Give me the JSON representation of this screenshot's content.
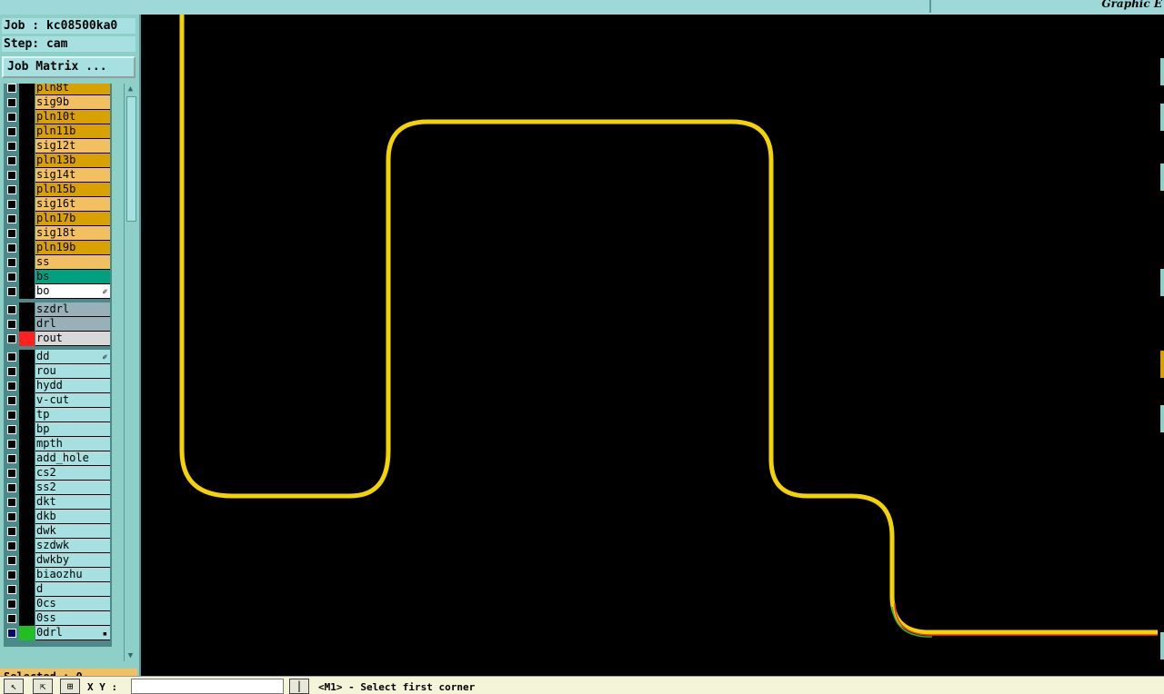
{
  "window": {
    "title": "Graphic E"
  },
  "job": {
    "label": "Job : kc08500ka0"
  },
  "step": {
    "label": "Step: cam"
  },
  "job_matrix_button": "Job Matrix ...",
  "selected": "Selected : 0",
  "bottom": {
    "xy_label": "X Y :",
    "xy_value": "",
    "status_message": "<M1> - Select first corner",
    "pipe_label": "|"
  },
  "layers": [
    {
      "name": "pln8t",
      "color": "#d8a000",
      "swatch": "",
      "checked": false
    },
    {
      "name": "sig9b",
      "color": "#f2c060",
      "swatch": "",
      "checked": false
    },
    {
      "name": "pln10t",
      "color": "#d8a000",
      "swatch": "",
      "checked": false
    },
    {
      "name": "pln11b",
      "color": "#d8a000",
      "swatch": "",
      "checked": false
    },
    {
      "name": "sig12t",
      "color": "#f2c060",
      "swatch": "",
      "checked": false
    },
    {
      "name": "pln13b",
      "color": "#d8a000",
      "swatch": "",
      "checked": false
    },
    {
      "name": "sig14t",
      "color": "#f2c060",
      "swatch": "",
      "checked": false
    },
    {
      "name": "pln15b",
      "color": "#d8a000",
      "swatch": "",
      "checked": false
    },
    {
      "name": "sig16t",
      "color": "#f2c060",
      "swatch": "",
      "checked": false
    },
    {
      "name": "pln17b",
      "color": "#d8a000",
      "swatch": "",
      "checked": false
    },
    {
      "name": "sig18t",
      "color": "#f2c060",
      "swatch": "",
      "checked": false
    },
    {
      "name": "pln19b",
      "color": "#d8a000",
      "swatch": "",
      "checked": false
    },
    {
      "name": "ss",
      "color": "#f2c060",
      "swatch": "",
      "checked": false
    },
    {
      "name": "bs",
      "color": "#00a080",
      "swatch": "",
      "checked": false
    },
    {
      "name": "bo",
      "color": "#ffffff",
      "swatch": "",
      "checked": false,
      "mark": "✐"
    },
    {
      "name": "szdrl",
      "color": "#98b0b8",
      "swatch": "",
      "checked": false
    },
    {
      "name": "drl",
      "color": "#98b0b8",
      "swatch": "",
      "checked": false
    },
    {
      "name": "rout",
      "color": "#d8d8d8",
      "swatch": "#ff2020",
      "checked": false
    },
    {
      "name": "dd",
      "color": "#a6e0e0",
      "swatch": "",
      "checked": false,
      "mark": "✐"
    },
    {
      "name": "rou",
      "color": "#a6e0e0",
      "swatch": "",
      "checked": false
    },
    {
      "name": "hydd",
      "color": "#a6e0e0",
      "swatch": "",
      "checked": false
    },
    {
      "name": "v-cut",
      "color": "#a6e0e0",
      "swatch": "",
      "checked": false
    },
    {
      "name": "tp",
      "color": "#a6e0e0",
      "swatch": "",
      "checked": false
    },
    {
      "name": "bp",
      "color": "#a6e0e0",
      "swatch": "",
      "checked": false
    },
    {
      "name": "mpth",
      "color": "#a6e0e0",
      "swatch": "",
      "checked": false
    },
    {
      "name": "add_hole",
      "color": "#a6e0e0",
      "swatch": "",
      "checked": false
    },
    {
      "name": "cs2",
      "color": "#a6e0e0",
      "swatch": "",
      "checked": false
    },
    {
      "name": "ss2",
      "color": "#a6e0e0",
      "swatch": "",
      "checked": false
    },
    {
      "name": "dkt",
      "color": "#a6e0e0",
      "swatch": "",
      "checked": false
    },
    {
      "name": "dkb",
      "color": "#a6e0e0",
      "swatch": "",
      "checked": false
    },
    {
      "name": "dwk",
      "color": "#a6e0e0",
      "swatch": "",
      "checked": false
    },
    {
      "name": "szdwk",
      "color": "#a6e0e0",
      "swatch": "",
      "checked": false
    },
    {
      "name": "dwkby",
      "color": "#a6e0e0",
      "swatch": "",
      "checked": false
    },
    {
      "name": "biaozhu",
      "color": "#a6e0e0",
      "swatch": "",
      "checked": false
    },
    {
      "name": "d",
      "color": "#a6e0e0",
      "swatch": "",
      "checked": false
    },
    {
      "name": "0cs",
      "color": "#a6e0e0",
      "swatch": "",
      "checked": false
    },
    {
      "name": "0ss",
      "color": "#a6e0e0",
      "swatch": "",
      "checked": false
    },
    {
      "name": "0drl",
      "color": "#a6e0e0",
      "swatch": "#20c020",
      "checked": true,
      "mark": "▪"
    }
  ],
  "canvas": {
    "trace_color": "#f5d300",
    "background": "#000000"
  },
  "icons": {
    "tool1": "select-arrow-icon",
    "tool2": "pointer-icon",
    "tool3": "grid-icon"
  }
}
